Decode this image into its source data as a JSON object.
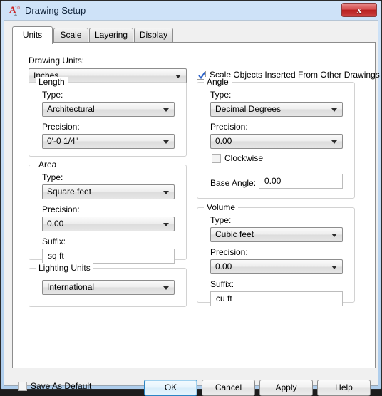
{
  "window": {
    "title": "Drawing Setup",
    "icon": "autocad-a10-icon",
    "close_label": "x",
    "accent_color": "#2c85c4",
    "titlebar_color": "#bfd8f2"
  },
  "tabs": [
    {
      "label": "Units",
      "active": true
    },
    {
      "label": "Scale",
      "active": false
    },
    {
      "label": "Layering",
      "active": false
    },
    {
      "label": "Display",
      "active": false
    }
  ],
  "units_tab": {
    "drawing_units": {
      "label": "Drawing Units:",
      "value": "Inches"
    },
    "scale_objects": {
      "label": "Scale Objects Inserted From Other Drawings",
      "checked": true
    },
    "length": {
      "title": "Length",
      "type_label": "Type:",
      "type_value": "Architectural",
      "precision_label": "Precision:",
      "precision_value": "0'-0 1/4\""
    },
    "area": {
      "title": "Area",
      "type_label": "Type:",
      "type_value": "Square feet",
      "precision_label": "Precision:",
      "precision_value": "0.00",
      "suffix_label": "Suffix:",
      "suffix_value": "sq ft"
    },
    "lighting_units": {
      "title": "Lighting Units",
      "value": "International"
    },
    "angle": {
      "title": "Angle",
      "type_label": "Type:",
      "type_value": "Decimal Degrees",
      "precision_label": "Precision:",
      "precision_value": "0.00",
      "clockwise_label": "Clockwise",
      "clockwise_checked": false,
      "base_angle_label": "Base Angle:",
      "base_angle_value": "0.00"
    },
    "volume": {
      "title": "Volume",
      "type_label": "Type:",
      "type_value": "Cubic feet",
      "precision_label": "Precision:",
      "precision_value": "0.00",
      "suffix_label": "Suffix:",
      "suffix_value": "cu ft"
    }
  },
  "footer": {
    "save_as_default": {
      "label": "Save As Default",
      "checked": false
    },
    "ok": "OK",
    "cancel": "Cancel",
    "apply": "Apply",
    "help": "Help"
  }
}
